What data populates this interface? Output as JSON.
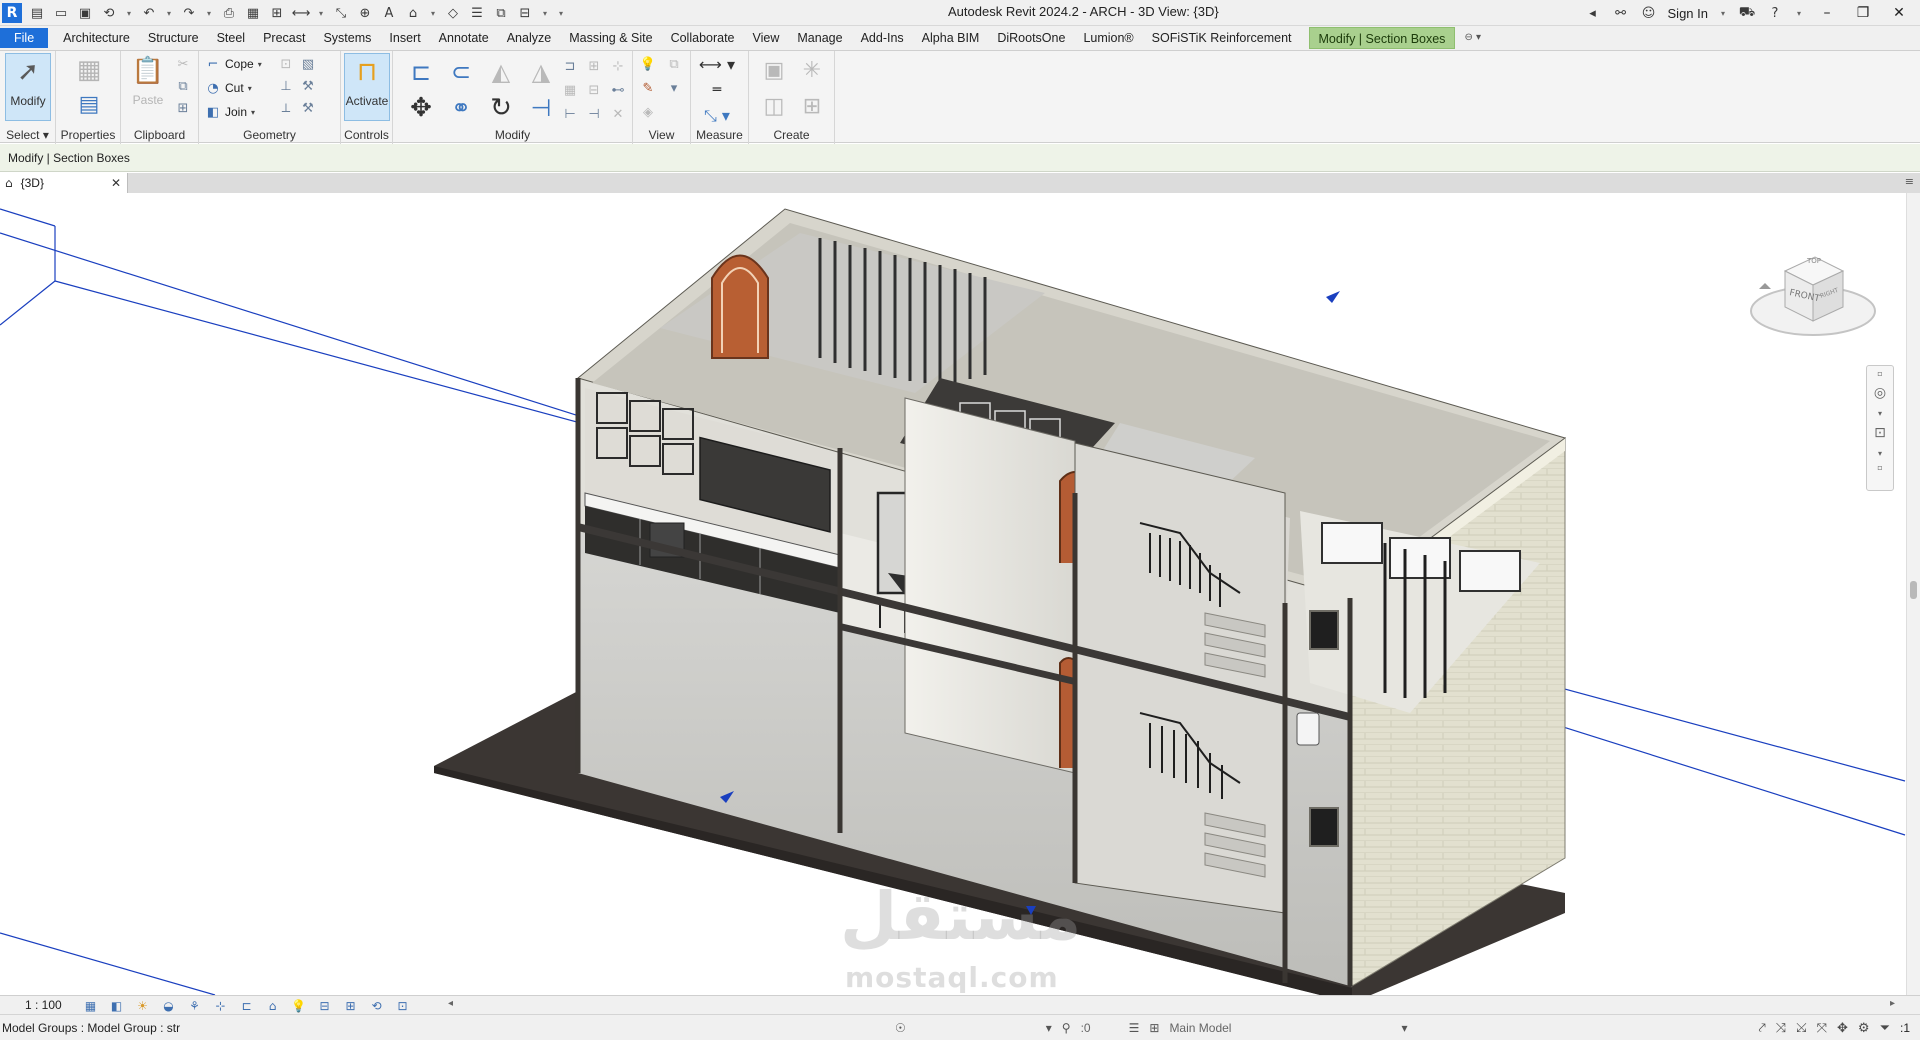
{
  "titlebar": {
    "app_title": "Autodesk Revit 2024.2 - ARCH - 3D View: {3D}",
    "sign_in": "Sign In",
    "qat_icons": [
      "revit-logo",
      "open-icon",
      "save-icon",
      "sync-icon",
      "undo-icon",
      "redo-icon",
      "print-icon",
      "measure-icon",
      "dimension-icon",
      "text-icon",
      "home-3d-icon",
      "section-icon",
      "thin-lines-icon",
      "switch-windows-icon"
    ]
  },
  "ribbon_tabs": {
    "file": "File",
    "items": [
      "Architecture",
      "Structure",
      "Steel",
      "Precast",
      "Systems",
      "Insert",
      "Annotate",
      "Analyze",
      "Massing & Site",
      "Collaborate",
      "View",
      "Manage",
      "Add-Ins",
      "Alpha BIM",
      "DiRootsOne",
      "Lumion®",
      "SOFiSTiK Reinforcement"
    ],
    "contextual": "Modify | Section Boxes"
  },
  "ribbon": {
    "select": {
      "modify_label": "Modify",
      "panel_title": "Select"
    },
    "properties": {
      "label": "Properties"
    },
    "clipboard": {
      "paste_label": "Paste",
      "panel_title": "Clipboard"
    },
    "geometry": {
      "cope_label": "Cope",
      "cut_label": "Cut",
      "join_label": "Join",
      "panel_title": "Geometry"
    },
    "controls": {
      "activate_label": "Activate",
      "panel_title": "Controls"
    },
    "modify": {
      "panel_title": "Modify"
    },
    "view": {
      "panel_title": "View"
    },
    "measure": {
      "panel_title": "Measure"
    },
    "create": {
      "panel_title": "Create"
    }
  },
  "options_bar": {
    "text": "Modify | Section Boxes"
  },
  "view_tab": {
    "label": "{3D}"
  },
  "viewcube": {
    "top_label": "TOP",
    "front_label": "FRONT",
    "right_label": "RIGHT"
  },
  "watermark": {
    "arabic": "مستقل",
    "latin": "mostaql.com"
  },
  "view_control": {
    "scale": "1 : 100"
  },
  "status_bar": {
    "selection": "Model Groups : Model Group : str",
    "zero_count": ":0",
    "model": "Main Model",
    "filter_count": ":1"
  },
  "colors": {
    "accent_blue": "#1e6fd9",
    "contextual_tab": "#a9d08e",
    "section_box_line": "#1a3fbf",
    "floor_slab": "#3b3633",
    "wall_light": "#e9e8e2"
  }
}
